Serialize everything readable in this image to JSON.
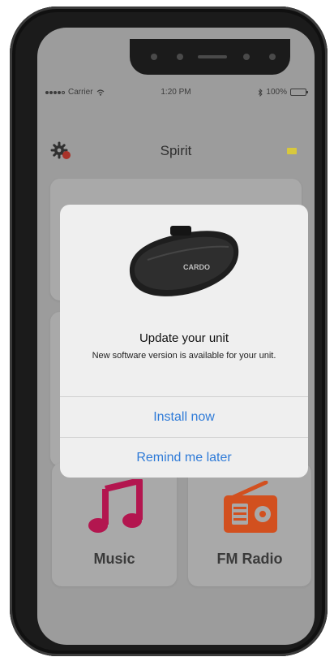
{
  "status_bar": {
    "carrier": "Carrier",
    "time": "1:20 PM",
    "battery": "100%"
  },
  "nav": {
    "title": "Spirit",
    "settings_icon": "gear-icon",
    "battery_indicator_color": "#d8c83c"
  },
  "tiles": [
    {
      "label": "Music",
      "icon": "music-note-icon",
      "color": "#b3164f"
    },
    {
      "label": "FM Radio",
      "icon": "radio-icon",
      "color": "#d2501f"
    }
  ],
  "dialog": {
    "title": "Update your unit",
    "message": "New software version is available for your unit.",
    "device_image": "intercom-device-image",
    "device_brand": "CARDO",
    "buttons": {
      "install": "Install now",
      "remind": "Remind me later"
    },
    "accent_color": "#2f7bd8"
  }
}
